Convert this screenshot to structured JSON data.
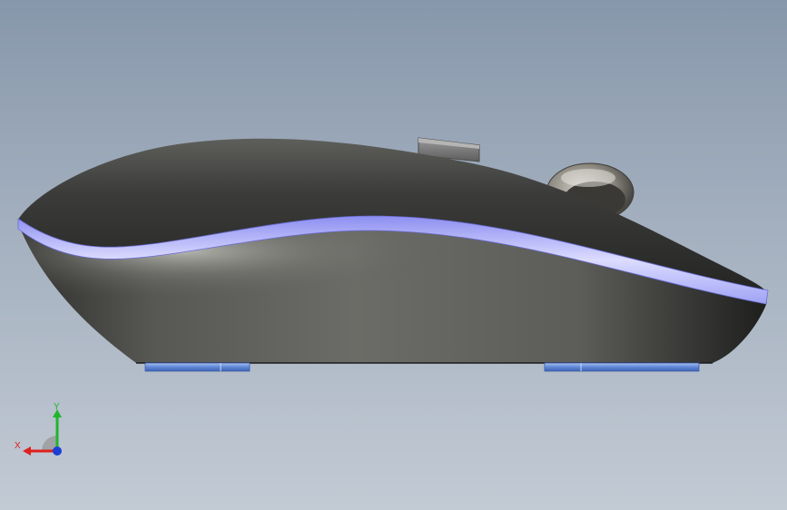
{
  "viewport": {
    "background_top": "#8797ab",
    "background_bottom": "#c2cad4"
  },
  "model": {
    "name": "wireless-mouse",
    "body_color": "#3c3d3b",
    "accent_stripe_color": "#b4b6ff",
    "feet_color": "#6a8fd8",
    "scroll_wheel_color": "#8e8b83",
    "usb_receiver_color": "#7d7d7d"
  },
  "triad": {
    "x_label": "X",
    "y_label": "Y",
    "x_color": "#e0201c",
    "y_color": "#1fb52d",
    "z_color": "#1c3fd6"
  }
}
